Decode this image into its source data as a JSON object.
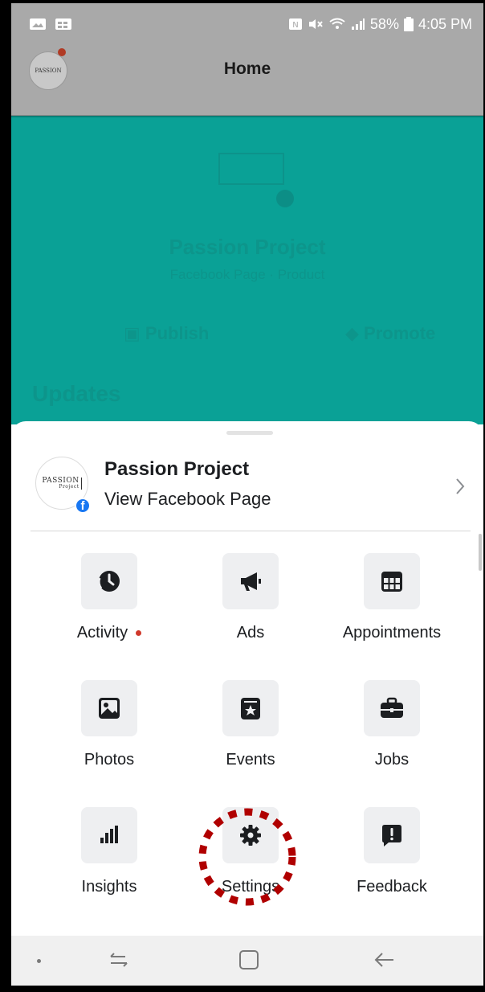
{
  "status_bar": {
    "battery": "58%",
    "time": "4:05 PM"
  },
  "app_bar": {
    "title": "Home",
    "avatar_text": "PASSION",
    "notification_dot_color": "#b03a24"
  },
  "background_page": {
    "page_name": "Passion Project",
    "page_subtitle": "Facebook Page · Product",
    "publish_label": "Publish",
    "promote_label": "Promote",
    "updates_heading": "Updates",
    "teal_color": "#0aa196"
  },
  "sheet": {
    "page": {
      "name": "Passion Project",
      "link_label": "View Facebook Page",
      "logo_text": "PASSION",
      "logo_subtext": "Project",
      "fb_badge": "f"
    },
    "tiles": [
      {
        "label": "Activity",
        "icon": "activity-clock-icon",
        "has_dot": true
      },
      {
        "label": "Ads",
        "icon": "megaphone-icon",
        "has_dot": false
      },
      {
        "label": "Appointments",
        "icon": "calendar-icon",
        "has_dot": false
      },
      {
        "label": "Photos",
        "icon": "photo-icon",
        "has_dot": false
      },
      {
        "label": "Events",
        "icon": "event-star-icon",
        "has_dot": false
      },
      {
        "label": "Jobs",
        "icon": "briefcase-icon",
        "has_dot": false
      },
      {
        "label": "Insights",
        "icon": "bar-chart-icon",
        "has_dot": false
      },
      {
        "label": "Settings",
        "icon": "gear-icon",
        "has_dot": false
      },
      {
        "label": "Feedback",
        "icon": "feedback-icon",
        "has_dot": false
      }
    ]
  },
  "annotation": {
    "highlight_target": "Settings",
    "highlight_color": "#b00000"
  }
}
